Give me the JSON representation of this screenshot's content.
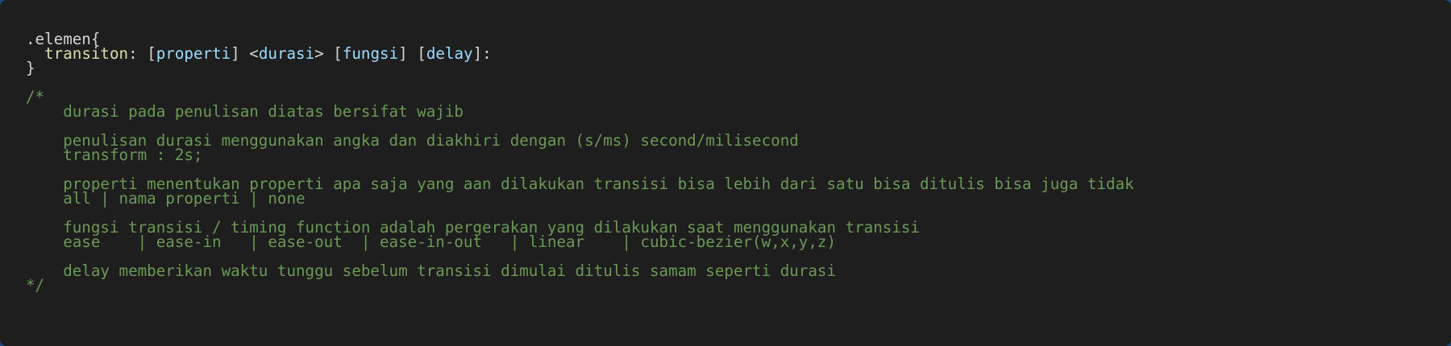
{
  "code": {
    "selector": ".elemen{",
    "indent": "  ",
    "property": "transiton",
    "colon": ": ",
    "lbracket1": "[",
    "param_properti": "properti",
    "rbracket1": "] ",
    "langle": "<",
    "param_durasi": "durasi",
    "rangle": "> ",
    "lbracket2": "[",
    "param_fungsi": "fungsi",
    "rbracket2": "] ",
    "lbracket3": "[",
    "param_delay": "delay",
    "end": "]:",
    "close_brace": "}",
    "comment_lines": [
      "/*",
      "    durasi pada penulisan diatas bersifat wajib",
      "",
      "    penulisan durasi menggunakan angka dan diakhiri dengan (s/ms) second/milisecond",
      "    transform : 2s;",
      "",
      "    properti menentukan properti apa saja yang aan dilakukan transisi bisa lebih dari satu bisa ditulis bisa juga tidak",
      "    all | nama properti | none",
      "",
      "    fungsi transisi / timing function adalah pergerakan yang dilakukan saat menggunakan transisi",
      "    ease    | ease-in   | ease-out  | ease-in-out   | linear    | cubic-bezier(w,x,y,z)",
      "",
      "    delay memberikan waktu tunggu sebelum transisi dimulai ditulis samam seperti durasi",
      "*/"
    ]
  }
}
